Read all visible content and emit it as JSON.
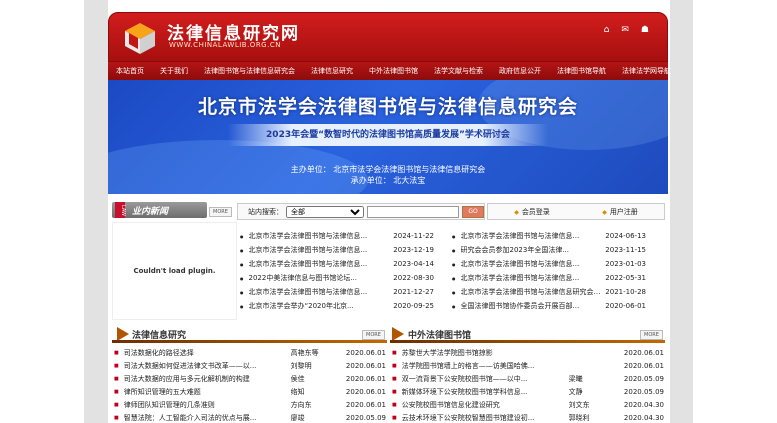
{
  "header": {
    "site_title": "法律信息研究网",
    "site_url": "WWW.CHINALAWLIB.ORG.CN",
    "icons": [
      "home-icon",
      "mail-icon",
      "people-icon"
    ]
  },
  "nav": [
    "本站首页",
    "关于我们",
    "法律图书馆与法律信息研究会",
    "法律信息研究",
    "中外法律图书馆",
    "法学文献与检索",
    "政府信息公开",
    "法律图书馆导航",
    "法律法学网导航"
  ],
  "banner": {
    "title": "北京市法学会法律图书馆与法律信息研究会",
    "subtitle": "2023年会暨“数智时代的法律图书馆高质量发展”学术研讨会",
    "organizer": "主办单位： 北京市法学会法律图书馆与法律信息研究会",
    "co_organizer": "承办单位： 北大法宝"
  },
  "news": {
    "tab_label": "业内新闻",
    "tab_badge": "LAW",
    "more_label": "MORE",
    "plugin_message": "Couldn't load plugin.",
    "items": [
      {
        "title": "北京市法学会法律图书馆与法律信息...",
        "date": "2024-11-22"
      },
      {
        "title": "北京市法学会法律图书馆与法律信息...",
        "date": "2024-06-13"
      },
      {
        "title": "北京市法学会法律图书馆与法律信息...",
        "date": "2023-12-19"
      },
      {
        "title": "研究会会员参加2023年全国法律...",
        "date": "2023-11-15"
      },
      {
        "title": "北京市法学会法律图书馆与法律信息...",
        "date": "2023-04-14"
      },
      {
        "title": "北京市法学会法律图书馆与法律信息...",
        "date": "2023-01-03"
      },
      {
        "title": "2022中美法律信息与图书馆论坛...",
        "date": "2022-08-30"
      },
      {
        "title": "北京市法学会法律图书馆与法律信息...",
        "date": "2022-05-31"
      },
      {
        "title": "北京市法学会法律图书馆与法律信息...",
        "date": "2021-12-27"
      },
      {
        "title": "北京市法学会法律图书馆与法律信息研究会通讯",
        "date": "2021-10-28"
      },
      {
        "title": "北京市法学会举办“2020年北京...",
        "date": "2020-09-25"
      },
      {
        "title": "全国法律图书馆协作委员会开展百部...",
        "date": "2020-06-01"
      }
    ]
  },
  "search": {
    "label": "站内搜索：",
    "selected_option": "全部",
    "input_value": "",
    "go_label": "GO"
  },
  "member": {
    "login_label": "会员登录",
    "register_label": "用户注册"
  },
  "research": {
    "title": "法律信息研究",
    "more_label": "MORE",
    "rows": [
      {
        "title": "司法数据化的路径选择",
        "author": "高艳东等",
        "date": "2020.06.01"
      },
      {
        "title": "司法大数据如何促进法律文书改革——以...",
        "author": "刘黎明",
        "date": "2020.06.01"
      },
      {
        "title": "司法大数据的应用与多元化解机制的构建",
        "author": "侯佳",
        "date": "2020.06.01"
      },
      {
        "title": "律所知识管理的五大难题",
        "author": "络知",
        "date": "2020.06.01"
      },
      {
        "title": "律师团队知识管理的几条准则",
        "author": "方向东",
        "date": "2020.06.01"
      },
      {
        "title": "智慧法院：人工智能介入司法的优点与展...",
        "author": "廖竣",
        "date": "2020.05.09"
      }
    ]
  },
  "libraries": {
    "title": "中外法律图书馆",
    "more_label": "MORE",
    "rows": [
      {
        "title": "苏黎世大学法学院图书馆掠影",
        "author": "",
        "date": "2020.06.01"
      },
      {
        "title": "法学院图书馆墙上的格言——访美国哈佛...",
        "author": "",
        "date": "2020.06.01"
      },
      {
        "title": "双一流背景下公安院校图书馆——以中...",
        "author": "梁曦",
        "date": "2020.05.09"
      },
      {
        "title": "新媒体环境下公安院校图书馆学科信息...",
        "author": "文静",
        "date": "2020.05.09"
      },
      {
        "title": "公安院校图书馆信息化建设研究",
        "author": "刘文东",
        "date": "2020.04.30"
      },
      {
        "title": "云技术环境下公安院校智慧图书馆建设初...",
        "author": "郭晓利",
        "date": "2020.04.30"
      }
    ]
  },
  "colors": {
    "header_red": "#c41515",
    "banner_blue": "#2a62de",
    "section_brown": "#8a3d00"
  }
}
